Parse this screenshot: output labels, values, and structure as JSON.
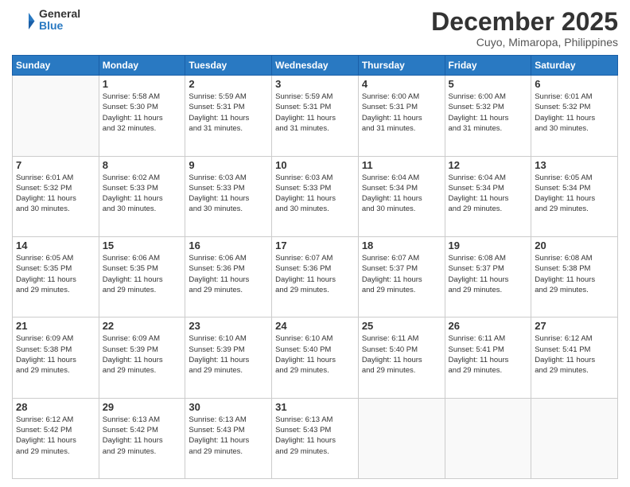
{
  "header": {
    "logo": {
      "general": "General",
      "blue": "Blue"
    },
    "title": "December 2025",
    "location": "Cuyo, Mimaropa, Philippines"
  },
  "calendar": {
    "days_of_week": [
      "Sunday",
      "Monday",
      "Tuesday",
      "Wednesday",
      "Thursday",
      "Friday",
      "Saturday"
    ],
    "weeks": [
      [
        {
          "day": "",
          "info": ""
        },
        {
          "day": "1",
          "info": "Sunrise: 5:58 AM\nSunset: 5:30 PM\nDaylight: 11 hours\nand 32 minutes."
        },
        {
          "day": "2",
          "info": "Sunrise: 5:59 AM\nSunset: 5:31 PM\nDaylight: 11 hours\nand 31 minutes."
        },
        {
          "day": "3",
          "info": "Sunrise: 5:59 AM\nSunset: 5:31 PM\nDaylight: 11 hours\nand 31 minutes."
        },
        {
          "day": "4",
          "info": "Sunrise: 6:00 AM\nSunset: 5:31 PM\nDaylight: 11 hours\nand 31 minutes."
        },
        {
          "day": "5",
          "info": "Sunrise: 6:00 AM\nSunset: 5:32 PM\nDaylight: 11 hours\nand 31 minutes."
        },
        {
          "day": "6",
          "info": "Sunrise: 6:01 AM\nSunset: 5:32 PM\nDaylight: 11 hours\nand 30 minutes."
        }
      ],
      [
        {
          "day": "7",
          "info": "Sunrise: 6:01 AM\nSunset: 5:32 PM\nDaylight: 11 hours\nand 30 minutes."
        },
        {
          "day": "8",
          "info": "Sunrise: 6:02 AM\nSunset: 5:33 PM\nDaylight: 11 hours\nand 30 minutes."
        },
        {
          "day": "9",
          "info": "Sunrise: 6:03 AM\nSunset: 5:33 PM\nDaylight: 11 hours\nand 30 minutes."
        },
        {
          "day": "10",
          "info": "Sunrise: 6:03 AM\nSunset: 5:33 PM\nDaylight: 11 hours\nand 30 minutes."
        },
        {
          "day": "11",
          "info": "Sunrise: 6:04 AM\nSunset: 5:34 PM\nDaylight: 11 hours\nand 30 minutes."
        },
        {
          "day": "12",
          "info": "Sunrise: 6:04 AM\nSunset: 5:34 PM\nDaylight: 11 hours\nand 29 minutes."
        },
        {
          "day": "13",
          "info": "Sunrise: 6:05 AM\nSunset: 5:34 PM\nDaylight: 11 hours\nand 29 minutes."
        }
      ],
      [
        {
          "day": "14",
          "info": "Sunrise: 6:05 AM\nSunset: 5:35 PM\nDaylight: 11 hours\nand 29 minutes."
        },
        {
          "day": "15",
          "info": "Sunrise: 6:06 AM\nSunset: 5:35 PM\nDaylight: 11 hours\nand 29 minutes."
        },
        {
          "day": "16",
          "info": "Sunrise: 6:06 AM\nSunset: 5:36 PM\nDaylight: 11 hours\nand 29 minutes."
        },
        {
          "day": "17",
          "info": "Sunrise: 6:07 AM\nSunset: 5:36 PM\nDaylight: 11 hours\nand 29 minutes."
        },
        {
          "day": "18",
          "info": "Sunrise: 6:07 AM\nSunset: 5:37 PM\nDaylight: 11 hours\nand 29 minutes."
        },
        {
          "day": "19",
          "info": "Sunrise: 6:08 AM\nSunset: 5:37 PM\nDaylight: 11 hours\nand 29 minutes."
        },
        {
          "day": "20",
          "info": "Sunrise: 6:08 AM\nSunset: 5:38 PM\nDaylight: 11 hours\nand 29 minutes."
        }
      ],
      [
        {
          "day": "21",
          "info": "Sunrise: 6:09 AM\nSunset: 5:38 PM\nDaylight: 11 hours\nand 29 minutes."
        },
        {
          "day": "22",
          "info": "Sunrise: 6:09 AM\nSunset: 5:39 PM\nDaylight: 11 hours\nand 29 minutes."
        },
        {
          "day": "23",
          "info": "Sunrise: 6:10 AM\nSunset: 5:39 PM\nDaylight: 11 hours\nand 29 minutes."
        },
        {
          "day": "24",
          "info": "Sunrise: 6:10 AM\nSunset: 5:40 PM\nDaylight: 11 hours\nand 29 minutes."
        },
        {
          "day": "25",
          "info": "Sunrise: 6:11 AM\nSunset: 5:40 PM\nDaylight: 11 hours\nand 29 minutes."
        },
        {
          "day": "26",
          "info": "Sunrise: 6:11 AM\nSunset: 5:41 PM\nDaylight: 11 hours\nand 29 minutes."
        },
        {
          "day": "27",
          "info": "Sunrise: 6:12 AM\nSunset: 5:41 PM\nDaylight: 11 hours\nand 29 minutes."
        }
      ],
      [
        {
          "day": "28",
          "info": "Sunrise: 6:12 AM\nSunset: 5:42 PM\nDaylight: 11 hours\nand 29 minutes."
        },
        {
          "day": "29",
          "info": "Sunrise: 6:13 AM\nSunset: 5:42 PM\nDaylight: 11 hours\nand 29 minutes."
        },
        {
          "day": "30",
          "info": "Sunrise: 6:13 AM\nSunset: 5:43 PM\nDaylight: 11 hours\nand 29 minutes."
        },
        {
          "day": "31",
          "info": "Sunrise: 6:13 AM\nSunset: 5:43 PM\nDaylight: 11 hours\nand 29 minutes."
        },
        {
          "day": "",
          "info": ""
        },
        {
          "day": "",
          "info": ""
        },
        {
          "day": "",
          "info": ""
        }
      ]
    ]
  }
}
